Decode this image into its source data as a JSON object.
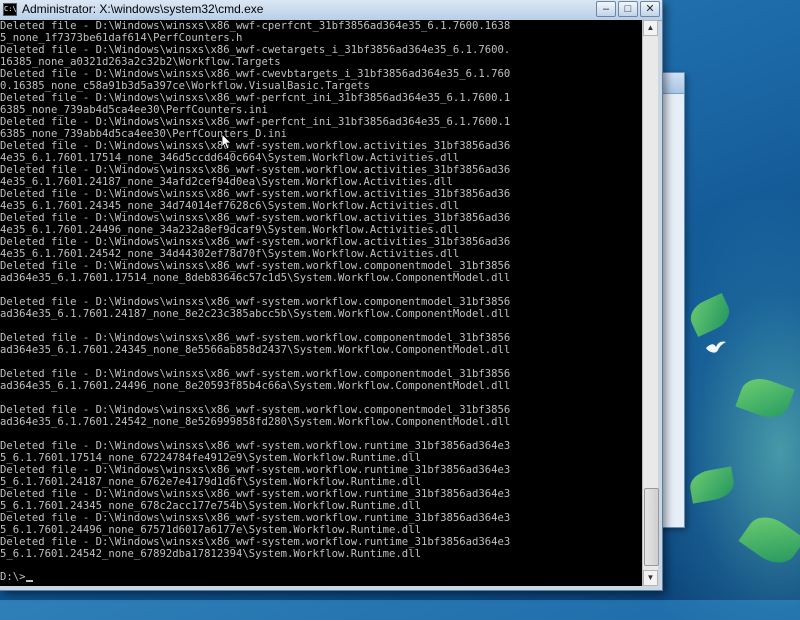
{
  "window": {
    "title": "Administrator: X:\\windows\\system32\\cmd.exe",
    "icon_label": "C:\\",
    "minimize_label": "–",
    "maximize_label": "□",
    "close_label": "✕"
  },
  "console": {
    "lines": [
      "Deleted file - D:\\Windows\\winsxs\\x86_wwf-cperfcnt_31bf3856ad364e35_6.1.7600.1638",
      "5_none_1f7373be61daf614\\PerfCounters.h",
      "Deleted file - D:\\Windows\\winsxs\\x86_wwf-cwetargets_i_31bf3856ad364e35_6.1.7600.",
      "16385_none_a0321d263a2c32b2\\Workflow.Targets",
      "Deleted file - D:\\Windows\\winsxs\\x86_wwf-cwevbtargets_i_31bf3856ad364e35_6.1.760",
      "0.16385_none_c58a91b3d5a397ce\\Workflow.VisualBasic.Targets",
      "Deleted file - D:\\Windows\\winsxs\\x86_wwf-perfcnt_ini_31bf3856ad364e35_6.1.7600.1",
      "6385_none_739ab4d5ca4ee30\\PerfCounters.ini",
      "Deleted file - D:\\Windows\\winsxs\\x86_wwf-perfcnt_ini_31bf3856ad364e35_6.1.7600.1",
      "6385_none_739abb4d5ca4ee30\\PerfCounters_D.ini",
      "Deleted file - D:\\Windows\\winsxs\\x86_wwf-system.workflow.activities_31bf3856ad36",
      "4e35_6.1.7601.17514_none_346d5ccdd640c664\\System.Workflow.Activities.dll",
      "Deleted file - D:\\Windows\\winsxs\\x86_wwf-system.workflow.activities_31bf3856ad36",
      "4e35_6.1.7601.24187_none_34afd2cef94d0ea\\System.Workflow.Activities.dll",
      "Deleted file - D:\\Windows\\winsxs\\x86_wwf-system.workflow.activities_31bf3856ad36",
      "4e35_6.1.7601.24345_none_34d74014ef7628c6\\System.Workflow.Activities.dll",
      "Deleted file - D:\\Windows\\winsxs\\x86_wwf-system.workflow.activities_31bf3856ad36",
      "4e35_6.1.7601.24496_none_34a232a8ef9dcaf9\\System.Workflow.Activities.dll",
      "Deleted file - D:\\Windows\\winsxs\\x86_wwf-system.workflow.activities_31bf3856ad36",
      "4e35_6.1.7601.24542_none_34d44302ef78d70f\\System.Workflow.Activities.dll",
      "Deleted file - D:\\Windows\\winsxs\\x86_wwf-system.workflow.componentmodel_31bf3856",
      "ad364e35_6.1.7601.17514_none_8deb83646c57c1d5\\System.Workflow.ComponentModel.dll",
      "",
      "Deleted file - D:\\Windows\\winsxs\\x86_wwf-system.workflow.componentmodel_31bf3856",
      "ad364e35_6.1.7601.24187_none_8e2c23c385abcc5b\\System.Workflow.ComponentModel.dll",
      "",
      "Deleted file - D:\\Windows\\winsxs\\x86_wwf-system.workflow.componentmodel_31bf3856",
      "ad364e35_6.1.7601.24345_none_8e5566ab858d2437\\System.Workflow.ComponentModel.dll",
      "",
      "Deleted file - D:\\Windows\\winsxs\\x86_wwf-system.workflow.componentmodel_31bf3856",
      "ad364e35_6.1.7601.24496_none_8e20593f85b4c66a\\System.Workflow.ComponentModel.dll",
      "",
      "Deleted file - D:\\Windows\\winsxs\\x86_wwf-system.workflow.componentmodel_31bf3856",
      "ad364e35_6.1.7601.24542_none_8e526999858fd280\\System.Workflow.ComponentModel.dll",
      "",
      "Deleted file - D:\\Windows\\winsxs\\x86_wwf-system.workflow.runtime_31bf3856ad364e3",
      "5_6.1.7601.17514_none_67224784fe4912e9\\System.Workflow.Runtime.dll",
      "Deleted file - D:\\Windows\\winsxs\\x86_wwf-system.workflow.runtime_31bf3856ad364e3",
      "5_6.1.7601.24187_none_6762e7e4179d1d6f\\System.Workflow.Runtime.dll",
      "Deleted file - D:\\Windows\\winsxs\\x86_wwf-system.workflow.runtime_31bf3856ad364e3",
      "5_6.1.7601.24345_none_678c2acc177e754b\\System.Workflow.Runtime.dll",
      "Deleted file - D:\\Windows\\winsxs\\x86_wwf-system.workflow.runtime_31bf3856ad364e3",
      "5_6.1.7601.24496_none_67571d6017a6177e\\System.Workflow.Runtime.dll",
      "Deleted file - D:\\Windows\\winsxs\\x86_wwf-system.workflow.runtime_31bf3856ad364e3",
      "5_6.1.7601.24542_none_67892dba17812394\\System.Workflow.Runtime.dll"
    ],
    "prompt": "D:\\>"
  },
  "scrollbar": {
    "up_arrow": "▲",
    "down_arrow": "▼"
  }
}
